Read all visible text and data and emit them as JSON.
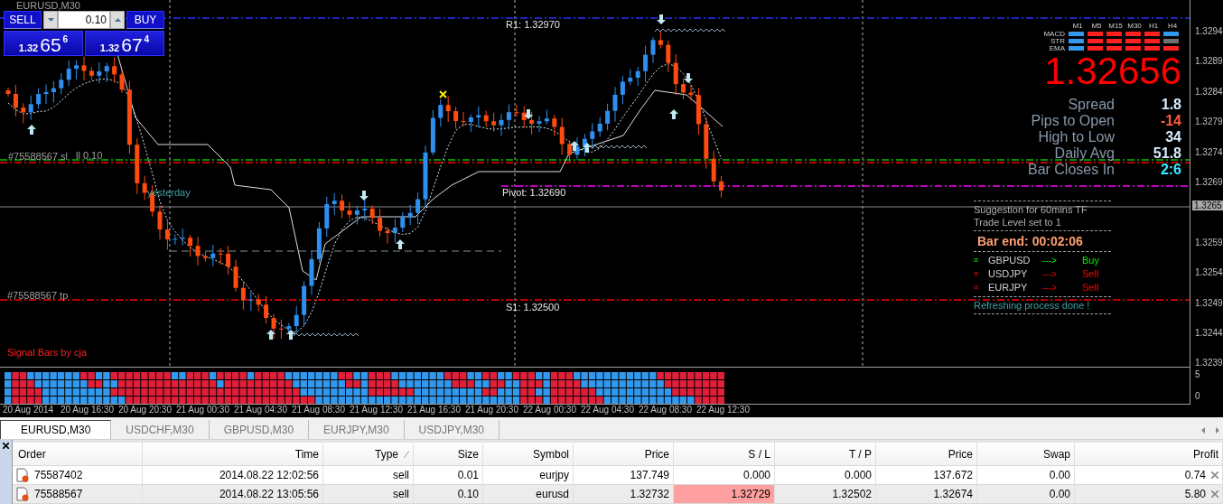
{
  "chart": {
    "title": "EURUSD,M30",
    "trade_panel": {
      "sell": "SELL",
      "buy": "BUY",
      "lot": "0.10",
      "bid": {
        "prefix": "1.32",
        "pips": "65",
        "fraction": "6"
      },
      "ask": {
        "prefix": "1.32",
        "pips": "67",
        "fraction": "4"
      }
    },
    "labels": [
      {
        "kind": "resistance",
        "text": "R1: 1.32970"
      },
      {
        "kind": "pivot",
        "text": "Pivot: 1.32690"
      },
      {
        "kind": "support",
        "text": "S1: 1.32500"
      },
      {
        "kind": "stop_loss",
        "text": "#75588567 sl"
      },
      {
        "kind": "order",
        "text": "ll 0.10"
      },
      {
        "kind": "take_profit",
        "text": "#75588567 tp"
      },
      {
        "kind": "session",
        "text": "yesterday"
      },
      {
        "kind": "credit",
        "text": "Signal Bars by cja"
      }
    ],
    "trend_matrix": {
      "timeframes": [
        "M1",
        "M5",
        "M15",
        "M30",
        "H1",
        "H4"
      ],
      "rows": [
        {
          "name": "MACD",
          "cells": [
            {
              "color": "#3399ee"
            },
            {
              "color": "#ff2020"
            },
            {
              "color": "#ff2020"
            },
            {
              "color": "#ff2020"
            },
            {
              "color": "#ff2020"
            },
            {
              "color": "#3399ee"
            }
          ]
        },
        {
          "name": "STR",
          "cells": [
            {
              "color": "#3399ee"
            },
            {
              "color": "#ff2020"
            },
            {
              "color": "#ff2020"
            },
            {
              "color": "#ff2020"
            },
            {
              "color": "#ff2020"
            },
            {
              "color": "#707070"
            }
          ]
        },
        {
          "name": "EMA",
          "cells": [
            {
              "color": "#3399ee"
            },
            {
              "color": "#ff2020"
            },
            {
              "color": "#ff2020"
            },
            {
              "color": "#ff2020"
            },
            {
              "color": "#ff2020"
            },
            {
              "color": "#ff2020"
            }
          ]
        }
      ]
    },
    "price": "1.32656",
    "stats": [
      {
        "label": "Spread",
        "value": "1.8",
        "color": "#d6ecff"
      },
      {
        "label": "Pips to Open",
        "value": "-14",
        "color": "#ff5a3c"
      },
      {
        "label": "High to Low",
        "value": "34",
        "color": "#d6ecff"
      },
      {
        "label": "Daily Avg",
        "value": "51.8",
        "color": "#d6ecff"
      },
      {
        "label": "Bar Closes In",
        "value": "2:6",
        "color": "#33eaff"
      }
    ],
    "suggestion": {
      "lines": [
        "Suggestion for 60mins TF",
        "Trade Level set to 1"
      ],
      "bar_end": "Bar end: 00:02:06",
      "signals": [
        {
          "mark": "¤",
          "symbol": "GBPUSD",
          "arrow": "--->",
          "action": "Buy",
          "color": "#00ee00"
        },
        {
          "mark": "¤",
          "symbol": "USDJPY",
          "arrow": "--->",
          "action": "Sell",
          "color": "#ff0000"
        },
        {
          "mark": "¤",
          "symbol": "EURJPY",
          "arrow": "--->",
          "action": "Sell",
          "color": "#ff0000"
        }
      ],
      "status": "Refreshing process done !"
    },
    "price_axis": [
      {
        "text": "1.3294",
        "kind": "tick"
      },
      {
        "text": "1.3289",
        "kind": "tick"
      },
      {
        "text": "1.3284",
        "kind": "tick"
      },
      {
        "text": "1.3279",
        "kind": "tick"
      },
      {
        "text": "1.3274",
        "kind": "tick"
      },
      {
        "text": "1.3269",
        "kind": "tick"
      },
      {
        "text": "1.3265",
        "kind": "current"
      },
      {
        "text": "1.3259",
        "kind": "tick"
      },
      {
        "text": "1.3254",
        "kind": "tick"
      },
      {
        "text": "1.3249",
        "kind": "tick"
      },
      {
        "text": "1.3244",
        "kind": "tick"
      },
      {
        "text": "1.3239",
        "kind": "tick"
      }
    ],
    "indicator_axis": [
      "5",
      "0"
    ],
    "time_axis": [
      "20 Aug 2014",
      "20 Aug 16:30",
      "20 Aug 20:30",
      "21 Aug 00:30",
      "21 Aug 04:30",
      "21 Aug 08:30",
      "21 Aug 12:30",
      "21 Aug 16:30",
      "21 Aug 20:30",
      "22 Aug 00:30",
      "22 Aug 04:30",
      "22 Aug 08:30",
      "22 Aug 12:30"
    ]
  },
  "symbol_tabs": [
    {
      "label": "EURUSD,M30",
      "selected": true
    },
    {
      "label": "USDCHF,M30",
      "selected": false
    },
    {
      "label": "GBPUSD,M30",
      "selected": false
    },
    {
      "label": "EURJPY,M30",
      "selected": false
    },
    {
      "label": "USDJPY,M30",
      "selected": false
    }
  ],
  "orders": {
    "columns": [
      {
        "label": "Order",
        "sorted": false
      },
      {
        "label": "Time",
        "sorted": false
      },
      {
        "label": "Type",
        "sorted": true
      },
      {
        "label": "Size",
        "sorted": false
      },
      {
        "label": "Symbol",
        "sorted": false
      },
      {
        "label": "Price",
        "sorted": false
      },
      {
        "label": "S / L",
        "sorted": false
      },
      {
        "label": "T / P",
        "sorted": false
      },
      {
        "label": "Price",
        "sorted": false
      },
      {
        "label": "Swap",
        "sorted": false
      },
      {
        "label": "Profit",
        "sorted": false
      }
    ],
    "rows": [
      {
        "cells": [
          "75587402",
          "2014.08.22 12:02:56",
          "sell",
          "0.01",
          "eurjpy",
          "137.749",
          "0.000",
          "0.000",
          "137.672",
          "0.00",
          "0.74"
        ],
        "sl_highlight": false
      },
      {
        "cells": [
          "75588567",
          "2014.08.22 13:05:56",
          "sell",
          "0.10",
          "eurusd",
          "1.32732",
          "1.32729",
          "1.32502",
          "1.32674",
          "0.00",
          "5.80"
        ],
        "sl_highlight": true
      }
    ]
  }
}
